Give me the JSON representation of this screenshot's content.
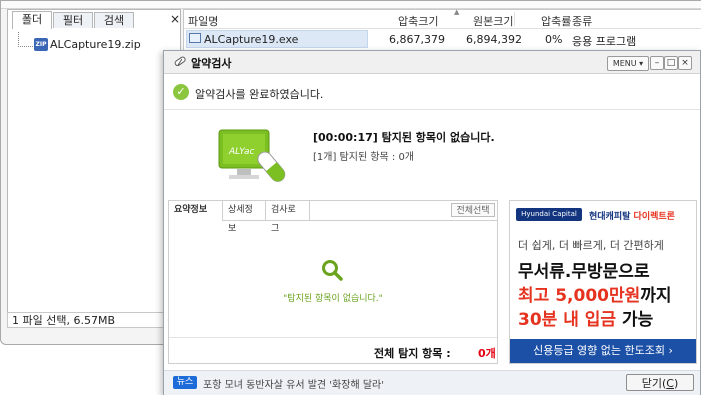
{
  "filemanager": {
    "tabs": [
      "폴더",
      "필터",
      "검색"
    ],
    "close_glyph": "×",
    "tree_item": "ALCapture19.zip",
    "zip_icon_label": "ZIP",
    "columns": {
      "name": "파일명",
      "compressed": "압축크기",
      "original": "원본크기",
      "ratio": "압축률",
      "type": "종류"
    },
    "file": {
      "name": "ALCapture19.exe",
      "compressed": "6,867,379",
      "original": "6,894,392",
      "ratio": "0%",
      "type": "응용 프로그램"
    },
    "status": "1 파일 선택, 6.57MB"
  },
  "dialog": {
    "title": "알약검사",
    "menu_label": "MENU ▾",
    "window_buttons": {
      "minimize": "–",
      "maximize": "□",
      "close": "×"
    },
    "done_message": "알약검사를 완료하였습니다.",
    "scan_result": "[00:00:17]  탐지된 항목이 없습니다.",
    "scan_count": "[1개] 탐지된 항목 : 0개",
    "logo_text": "ALYac",
    "tabs": [
      "요약정보",
      "상세정보",
      "검사로그"
    ],
    "select_all": "전체선택",
    "empty_message": "\"탐지된 항목이 없습니다.\"",
    "total_label": "전체 탐지 항목 :",
    "total_value": "0개",
    "news_badge": "뉴스",
    "news_text": "포항 모녀 동반자살 유서 발견 '화장해 달라'",
    "close_label_pre": "닫기(",
    "close_label_key": "C",
    "close_label_post": ")"
  },
  "ad": {
    "brand": "Hyundai Capital",
    "brand_kr": "현대캐피탈",
    "brand_kr2": "다이렉트론",
    "line1": "더 쉽게, 더 빠르게, 더 간편하게",
    "line2": "무서류.무방문으로",
    "line3_red": "최고 5,000만원",
    "line3_rest": "까지",
    "line4_red": "30분 내 입금",
    "line4_rest": " 가능",
    "cta": "신용등급 영향 없는 한도조회 ›"
  },
  "colors": {
    "accent_blue": "#1c50a7",
    "check_green": "#8cc63f",
    "alert_red": "#e60012"
  }
}
